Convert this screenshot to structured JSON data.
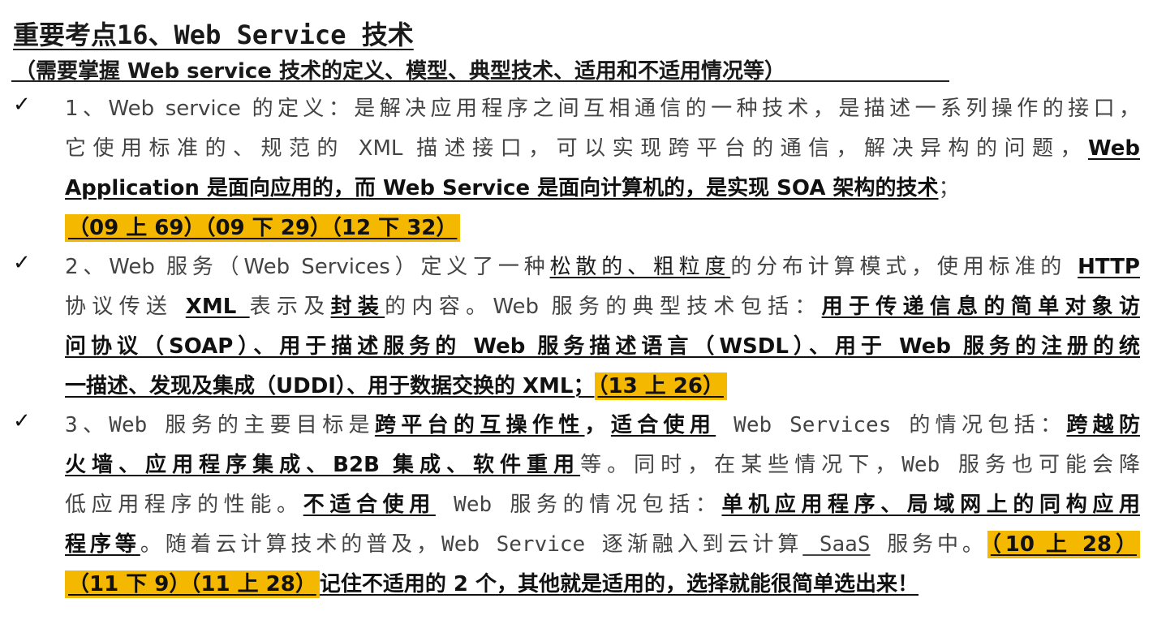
{
  "title": "重要考点16、Web Service 技术",
  "subtitle": "（需要掌握 Web service 技术的定义、模型、典型技术、适用和不适用情况等）",
  "check_mark": "✓",
  "p1": {
    "l1": "1、Web service 的定义：是解决应用程序之间互相通信的一种技术，是描述一系列操作的接口，",
    "l2a": "它使用标准的、规范的 XML 描述接口，可以实现跨平台的通信，解决异构的问题，",
    "l2b": "Web",
    "l3a": "Application 是面向应用的，而 Web Service 是面向计算机的，是实现 SOA 架构的技术",
    "l3b": "；",
    "ref": "（09 上 69）（09 下 29）（12 下 32）"
  },
  "p2": {
    "a": "2、Web  服务（Web Services）定义了一种",
    "b": "松散的、粗粒度",
    "c": "的分布计算模式，使用标准的 ",
    "d": "HTTP",
    "e": "协议传送 ",
    "f": "XML ",
    "g": "表示及",
    "h": "封装",
    "i": "的内容。Web 服务的典型技术包括：",
    "j": "用于传递信息的简单对象访",
    "k": "问协议（SOAP）、用于描述服务的 Web 服务描述语言（WSDL）、用于 Web 服务的注册的统",
    "l": "一描述、发现及集成（UDDI）、用于数据交换的 XML；",
    "ref": "（13 上 26）"
  },
  "p3": {
    "a": "3、Web 服务的主要目标是",
    "b": "跨平台的互操作性",
    "c": "，",
    "d": "适合使用",
    "e": " Web Services 的情况包括：",
    "f": "跨越防",
    "g": "火墙、应用程序集成、B2B 集成、软件重用",
    "h": "等。同时，在某些情况下，Web 服务也可能会降",
    "i": "低应用程序的性能。",
    "j": "不适合使用",
    "k": " Web 服务的情况包括：",
    "l": "单机应用程序、局域网上的同构应用",
    "m": "程序等",
    "n": "。随着云计算技术的普及，Web Service 逐渐融入到云计算",
    "o": " SaaS",
    "p": " 服务中。",
    "ref1": "（10 上 28）",
    "ref2": "（11 下 9）（11 上 28）",
    "tail": "记住不适用的 2 个，其他就是适用的，选择就能很简单选出来！"
  }
}
